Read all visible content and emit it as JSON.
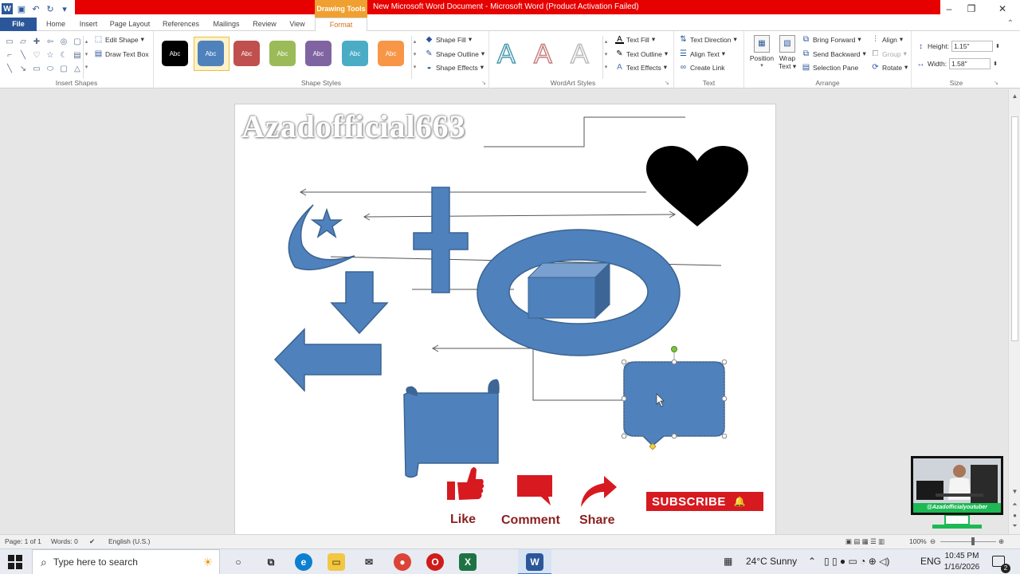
{
  "window": {
    "title": "New Microsoft Word Document - Microsoft Word (Product Activation Failed)",
    "context_tab_group": "Drawing Tools"
  },
  "tabs": [
    {
      "label": "File"
    },
    {
      "label": "Home"
    },
    {
      "label": "Insert"
    },
    {
      "label": "Page Layout"
    },
    {
      "label": "References"
    },
    {
      "label": "Mailings"
    },
    {
      "label": "Review"
    },
    {
      "label": "View"
    },
    {
      "label": "Format"
    }
  ],
  "ribbon": {
    "insert_shapes": {
      "label": "Insert Shapes",
      "edit_shape": "Edit Shape",
      "draw_text_box": "Draw Text Box"
    },
    "shape_styles": {
      "label": "Shape Styles",
      "swatch_text": "Abc",
      "swatches": [
        "#000000",
        "#4f81bd",
        "#c0504d",
        "#9bbb59",
        "#8064a2",
        "#4bacc6",
        "#f79646"
      ],
      "shape_fill": "Shape Fill",
      "shape_outline": "Shape Outline",
      "shape_effects": "Shape Effects"
    },
    "wordart": {
      "label": "WordArt Styles",
      "letter": "A",
      "text_fill": "Text Fill",
      "text_outline": "Text Outline",
      "text_effects": "Text Effects"
    },
    "text": {
      "label": "Text",
      "text_direction": "Text Direction",
      "align_text": "Align Text",
      "create_link": "Create Link"
    },
    "arrange": {
      "label": "Arrange",
      "position": "Position",
      "wrap_text_1": "Wrap",
      "wrap_text_2": "Text",
      "bring_forward": "Bring Forward",
      "send_backward": "Send Backward",
      "selection_pane": "Selection Pane",
      "align": "Align",
      "group": "Group",
      "rotate": "Rotate"
    },
    "size": {
      "label": "Size",
      "height_label": "Height:",
      "height_value": "1.15\"",
      "width_label": "Width:",
      "width_value": "1.58\""
    }
  },
  "document": {
    "watermark": "Azadofficial663",
    "social": {
      "like": "Like",
      "comment": "Comment",
      "share": "Share",
      "subscribe": "SUBSCRIBE"
    },
    "shape_color": "#4f81bd"
  },
  "webcam": {
    "caption": "@Azadofficialyoutuber"
  },
  "statusbar": {
    "page": "Page: 1 of 1",
    "words": "Words: 0",
    "language": "English (U.S.)",
    "zoom": "100%"
  },
  "taskbar": {
    "search_placeholder": "Type here to search",
    "weather": "24°C  Sunny",
    "language": "ENG",
    "time": "10:45 PM",
    "date": "1/16/2026",
    "notification_count": "2"
  }
}
